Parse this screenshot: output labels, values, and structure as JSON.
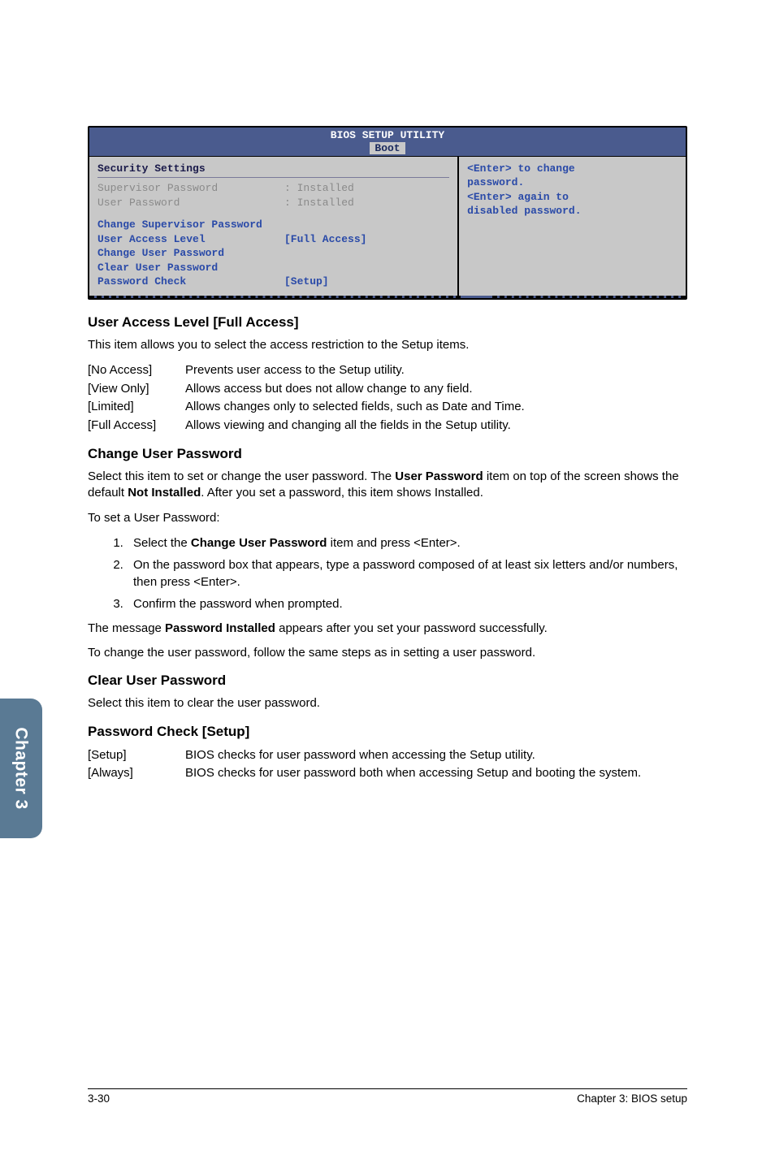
{
  "bios": {
    "title": "BIOS SETUP UTILITY",
    "tab": "Boot",
    "left": {
      "heading": "Security Settings",
      "sup_label": "Supervisor Password",
      "sup_value": ": Installed",
      "user_label": "User Password",
      "user_value": ": Installed",
      "chg_sup": "Change Supervisor Password",
      "ual_label": "User Access Level",
      "ual_value": "[Full Access]",
      "chg_user": "Change User Password",
      "clr_user": "Clear User Password",
      "pwc_label": "Password Check",
      "pwc_value": "[Setup]"
    },
    "right": {
      "l1": "<Enter> to change",
      "l2": "password.",
      "l3": "<Enter> again to",
      "l4": "disabled password."
    }
  },
  "sections": {
    "ual": {
      "heading": "User Access Level [Full Access]",
      "intro": "This item allows you to select the access restriction to the Setup items.",
      "opts": [
        {
          "k": "[No Access]",
          "v": "Prevents user access to the Setup utility."
        },
        {
          "k": "[View Only]",
          "v": "Allows access but does not allow change to any field."
        },
        {
          "k": "[Limited]",
          "v": "Allows changes only to selected fields, such as Date and Time."
        },
        {
          "k": "[Full Access]",
          "v": "Allows viewing and changing all the fields in the Setup utility."
        }
      ]
    },
    "cup": {
      "heading": "Change User Password",
      "p1a": "Select this item to set or change the user password. The ",
      "p1b": "User Password",
      "p1c": " item on top of the screen shows the default ",
      "p1d": "Not Installed",
      "p1e": ". After you set a password, this item shows Installed.",
      "p2": "To set a User Password:",
      "steps": [
        {
          "pre": "Select the ",
          "bold": "Change User Password",
          "post": " item and press <Enter>."
        },
        {
          "pre": "On the password box that appears, type a password composed of at least six letters and/or numbers, then press <Enter>.",
          "bold": "",
          "post": ""
        },
        {
          "pre": "Confirm the password when prompted.",
          "bold": "",
          "post": ""
        }
      ],
      "p3a": "The message ",
      "p3b": "Password Installed",
      "p3c": " appears after you set your password successfully.",
      "p4": "To change the user password, follow the same steps as in setting a user password."
    },
    "clear": {
      "heading": "Clear User Password",
      "p": "Select this item to clear the user password."
    },
    "pwc": {
      "heading": "Password Check [Setup]",
      "opts": [
        {
          "k": "[Setup]",
          "v": "BIOS checks for user password when accessing the Setup utility."
        },
        {
          "k": "[Always]",
          "v": "BIOS checks for user password both when accessing Setup and booting the system."
        }
      ]
    }
  },
  "sidebar": {
    "label": "Chapter 3"
  },
  "footer": {
    "left": "3-30",
    "right": "Chapter 3: BIOS setup"
  }
}
